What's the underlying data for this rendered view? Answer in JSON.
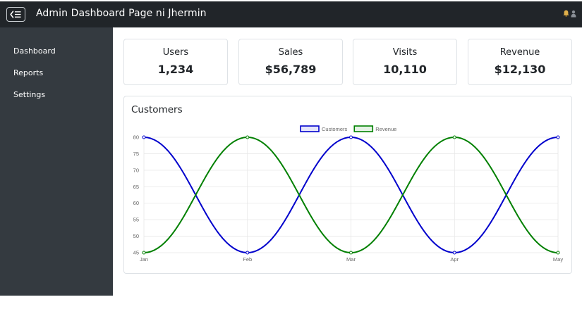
{
  "header": {
    "title": "Admin Dashboard Page ni Jhermin",
    "toggle_icon": "sidebar-toggle-icon"
  },
  "sidebar": {
    "items": [
      {
        "label": "Dashboard"
      },
      {
        "label": "Reports"
      },
      {
        "label": "Settings"
      }
    ]
  },
  "stats": [
    {
      "label": "Users",
      "value": "1,234"
    },
    {
      "label": "Sales",
      "value": "$56,789"
    },
    {
      "label": "Visits",
      "value": "10,110"
    },
    {
      "label": "Revenue",
      "value": "$12,130"
    }
  ],
  "chart_card": {
    "title": "Customers"
  },
  "chart_data": {
    "type": "line",
    "categories": [
      "Jan",
      "Feb",
      "Mar",
      "Apr",
      "May"
    ],
    "series": [
      {
        "name": "Customers",
        "values": [
          80,
          45,
          80,
          45,
          80
        ],
        "color": "#0000cc"
      },
      {
        "name": "Revenue",
        "values": [
          45,
          80,
          45,
          80,
          45
        ],
        "color": "#008000"
      }
    ],
    "ylim": [
      45,
      80
    ],
    "yticks": [
      45,
      50,
      55,
      60,
      65,
      70,
      75,
      80
    ],
    "grid": true,
    "legend": "top-center"
  }
}
